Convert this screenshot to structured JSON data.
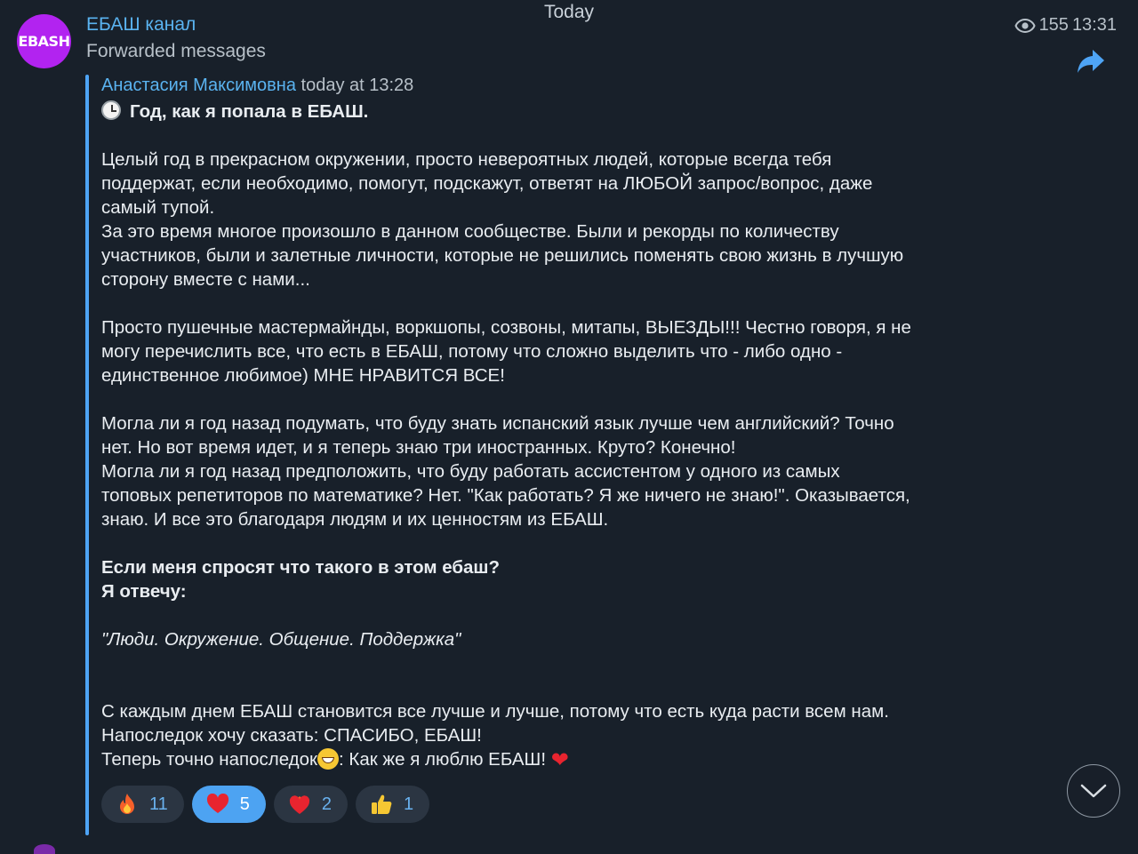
{
  "date_label": "Today",
  "channel": {
    "avatar_text": "EBASH",
    "avatar_color": "#b223f0",
    "name": "ЕБАШ канал",
    "subtitle": "Forwarded messages",
    "views": "155",
    "time": "13:31"
  },
  "forward": {
    "author": "Анастасия Максимовна",
    "time": "today at 13:28"
  },
  "message": {
    "title": "Год, как я попала в ЕБАШ.",
    "p1": "Целый год в прекрасном окружении, просто невероятных людей,  которые всегда тебя",
    "p2": "поддержат, если необходимо, помогут, подскажут, ответят на ЛЮБОЙ запрос/вопрос, даже",
    "p3": "самый тупой.",
    "p4": "За это время многое произошло в данном сообществе. Были и рекорды по количеству",
    "p5": "участников, были и залетные личности, которые не решились поменять свою жизнь в лучшую",
    "p6": "сторону вместе с нами...",
    "p7": "Просто пушечные мастермайнды, воркшопы, созвоны, митапы, ВЫЕЗДЫ!!! Честно говоря, я не",
    "p8": "могу перечислить все, что есть в ЕБАШ, потому что сложно выделить что - либо одно -",
    "p9": "единственное любимое) МНЕ НРАВИТСЯ ВСЕ!",
    "p10": "Могла ли я год назад подумать, что буду знать испанский язык лучше чем английский? Точно",
    "p11": "нет. Но вот время идет, и я теперь знаю три иностранных. Круто? Конечно!",
    "p12": "Могла ли я год назад предположить, что буду работать ассистентом у одного из самых",
    "p13": "топовых репетиторов по математике? Нет. \"Как работать? Я же ничего не знаю!\". Оказывается,",
    "p14": "знаю. И все это благодаря людям  и их ценностям из ЕБАШ.",
    "b1": "Если меня спросят что такого в этом ебаш?",
    "b2": "Я отвечу:",
    "quote": "\"Люди. Окружение. Общение. Поддержка\"",
    "p15": "С каждым днем ЕБАШ становится все лучше и лучше, потому что есть куда расти всем нам.",
    "p16": "Напоследок хочу сказать: СПАСИБО, ЕБАШ!",
    "p17a": "Теперь точно напоследок",
    "p17b": ": Как же я люблю ЕБАШ! "
  },
  "reactions": [
    {
      "icon": "fire-icon",
      "count": "11",
      "active": false
    },
    {
      "icon": "heart-icon",
      "count": "5",
      "active": true
    },
    {
      "icon": "heart-on-fire-icon",
      "count": "2",
      "active": false
    },
    {
      "icon": "thumbs-up-icon",
      "count": "1",
      "active": false
    }
  ],
  "colors": {
    "background": "#18202a",
    "accent": "#4da3f2",
    "link": "#5ab3f0"
  }
}
